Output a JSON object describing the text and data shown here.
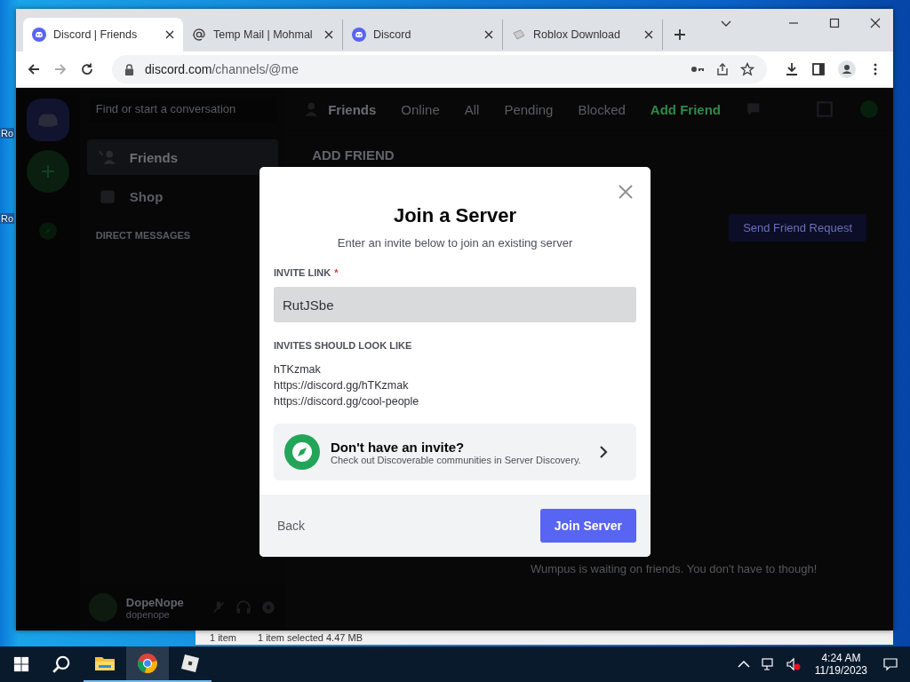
{
  "desktop_icons": [
    {
      "label": "Ro"
    },
    {
      "label": "Ro"
    }
  ],
  "explorer_status": {
    "items": "1 item",
    "selected": "1 item selected  4.47 MB"
  },
  "browser": {
    "tabs": [
      {
        "title": "Discord | Friends",
        "kind": "discord",
        "selected": true
      },
      {
        "title": "Temp Mail | Mohmal",
        "kind": "at",
        "selected": false
      },
      {
        "title": "Discord",
        "kind": "discord",
        "selected": false
      },
      {
        "title": "Roblox Download",
        "kind": "roblox",
        "selected": false
      }
    ],
    "url_host": "discord.com",
    "url_path": "/channels/@me"
  },
  "discord": {
    "search_placeholder": "Find or start a conversation",
    "nav": [
      {
        "label": "Friends",
        "kind": "friends",
        "selected": true
      },
      {
        "label": "Shop",
        "kind": "shop",
        "selected": false
      }
    ],
    "dm_heading": "DIRECT MESSAGES",
    "header_title": "Friends",
    "header_tabs": [
      {
        "label": "Online",
        "kind": "tab"
      },
      {
        "label": "All",
        "kind": "tab"
      },
      {
        "label": "Pending",
        "kind": "tab"
      },
      {
        "label": "Blocked",
        "kind": "tab"
      },
      {
        "label": "Add Friend",
        "kind": "action"
      }
    ],
    "section_title": "ADD FRIEND",
    "send_button": "Send Friend Request",
    "empty_text": "Wumpus is waiting on friends. You don't have to though!",
    "user": {
      "name": "DopeNope",
      "tag": "dopenope"
    }
  },
  "modal": {
    "title": "Join a Server",
    "subtitle": "Enter an invite below to join an existing server",
    "field_label": "INVITE LINK",
    "required_mark": "*",
    "value": "RutJSbe",
    "examples_title": "INVITES SHOULD LOOK LIKE",
    "examples": [
      "hTKzmak",
      "https://discord.gg/hTKzmak",
      "https://discord.gg/cool-people"
    ],
    "discovery_title": "Don't have an invite?",
    "discovery_text": "Check out Discoverable communities in Server Discovery.",
    "back": "Back",
    "join": "Join Server"
  },
  "taskbar": {
    "apps": [
      {
        "kind": "explorer",
        "selected": false
      },
      {
        "kind": "chrome",
        "selected": true
      },
      {
        "kind": "roblox",
        "selected": false
      }
    ],
    "time": "4:24 AM",
    "date": "11/19/2023"
  }
}
